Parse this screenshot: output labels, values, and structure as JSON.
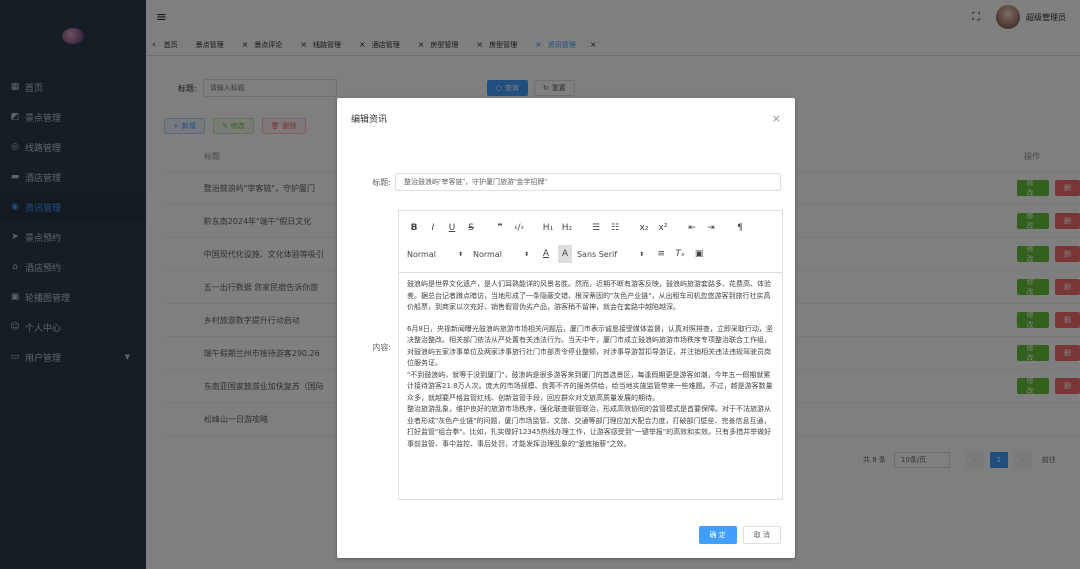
{
  "header": {
    "user_name": "超级管理员"
  },
  "sidebar": {
    "items": [
      {
        "label": "首页",
        "icon": "dashboard-icon"
      },
      {
        "label": "景点管理",
        "icon": "scenic-icon"
      },
      {
        "label": "线路管理",
        "icon": "route-icon"
      },
      {
        "label": "酒店管理",
        "icon": "hotel-icon"
      },
      {
        "label": "资讯管理",
        "icon": "news-icon",
        "active": true
      },
      {
        "label": "景点预约",
        "icon": "send-icon"
      },
      {
        "label": "酒店预约",
        "icon": "home-icon"
      },
      {
        "label": "轮播图管理",
        "icon": "image-icon"
      },
      {
        "label": "个人中心",
        "icon": "user-icon"
      },
      {
        "label": "用户管理",
        "icon": "users-icon"
      }
    ]
  },
  "tags": [
    {
      "label": "首页"
    },
    {
      "label": "景点管理"
    },
    {
      "label": "景点评论"
    },
    {
      "label": "线路管理"
    },
    {
      "label": "酒店管理"
    },
    {
      "label": "房型管理"
    },
    {
      "label": "房型管理"
    },
    {
      "label": "资讯管理",
      "active": true
    }
  ],
  "search": {
    "label": "标题:",
    "placeholder": "请输入标题",
    "search_button": "查询",
    "reset_button": "重置"
  },
  "toolbar": {
    "add": "新增",
    "edit": "修改",
    "delete": "删除"
  },
  "table": {
    "col_title": "标题",
    "col_op": "操作",
    "edit_label": "修改",
    "delete_label": "删",
    "rows": [
      "整治鼓浪屿\"宰客链\"，守护厦门",
      "黔东南2024年\"端午\"假日文化",
      "中国现代化设施、文化体验等吸引",
      "五一出行数据 您家民宿告诉你旅",
      "乡村旅游数字提升行动启动",
      "端午假期兰州市接待游客290.26",
      "东南亚国家旅游业加快复苏（国际",
      "松峰山一日游攻略"
    ]
  },
  "pager": {
    "total": "共 8 条",
    "size": "10条/页",
    "current": "1",
    "jump": "前往"
  },
  "dialog": {
    "title": "编辑资讯",
    "title_label": "标题:",
    "title_value": "整治鼓浪屿\"宰客链\"，守护厦门旅游\"金字招牌\"",
    "content_label": "内容:",
    "toolbar": {
      "header_select": "Normal",
      "size_select": "Normal",
      "font_select": "Sans Serif"
    },
    "paragraphs": [
      "鼓浪屿是世界文化遗产，是人们耳熟能详的风景名胜。然而，近期不断有游客反映，鼓浪屿旅游套路多、花费高、体验差。据总台记者蹲点暗访，当地形成了一条隐蔽交错、根深蒂固的\"灰色产业链\"，从出租车司机忽悠游客到旅行社实高价船票，到商家以次充好、销售假冒伪劣产品，游客稍不留神，就会在套路中越陷越深。",
      "6月8日，央视新闻曝光鼓浪屿旅游市场相关问题后，厦门市表示诚恳接受媒体监督，认真对照排查，立即采取行动，坚决整治整改。相关部门依法从严处置有关违法行为。当天中午，厦门市成立鼓浪屿旅游市场秩序专项整治联合工作组，对鼓浪屿五家涉事单位及两家涉事旅行社门市部责令停业整顿，对涉事导游暂扣导游证，并注销相关违法违规驾驶员岗位服务证。",
      "\"不到鼓浪屿，就等于没到厦门\"，鼓浪屿是很多游客来到厦门的首选景区，每逢假期更是游客如潮，今年五一假期就累计接待游客21.8万人次。庞大的市场规模、良莠不齐的服务供给，给当地实施监管带来一些难题。不过，越是游客数量众多，就越要严格监管红线、创新监管手段，回应群众对文旅高质量发展的期待。",
      "整治旅游乱象，维护良好的旅游市场秩序，强化联查联管联治，形成高效协同的监管模式是首要保障。对于不法旅游从业者形成\"灰色产业链\"的问题，厦门市场监管、文旅、交通等部门理应加大配合力度，打破部门壁垒、完善信息互通，打好监管\"组合拳\"。比如，扎实做好12345热线办理工作，让游客感受到\"一键举报\"的高效和实效。只有多措并举做好事前监管、事中监控、事后处罚，才能发挥治理乱象的\"釜底抽薪\"之效。"
    ],
    "confirm": "确 定",
    "cancel": "取 消"
  }
}
